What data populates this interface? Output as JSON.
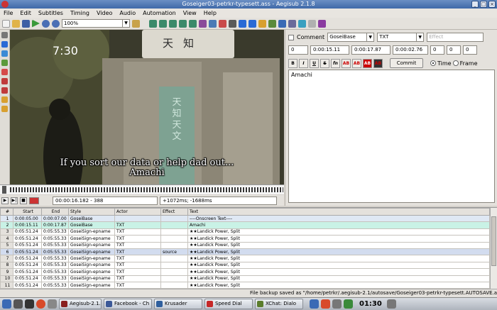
{
  "window": {
    "title": "Goseiger03-petrkr-typesett.ass - Aegisub 2.1.8"
  },
  "menu": [
    "File",
    "Edit",
    "Subtitles",
    "Timing",
    "Video",
    "Audio",
    "Automation",
    "View",
    "Help"
  ],
  "toolbar": {
    "zoom": "100%"
  },
  "video": {
    "clock_overlay": "7:30",
    "sign_text": "天知",
    "pillar_text": "天知天文",
    "subtitle_line1": "If you sort our data or help dad out...",
    "subtitle_line2": "Amachi"
  },
  "video_controls": {
    "position": "00:00:16.182 - 388",
    "offset": "+1072ms; -1688ms"
  },
  "editor": {
    "comment_label": "Comment",
    "style": "GoseiBase",
    "actor": "TXT",
    "effect_placeholder": "Effect",
    "layer": "0",
    "start": "0:00:15.11",
    "end": "0:00:17.87",
    "duration": "0:00:02.76",
    "margin_l": "0",
    "margin_r": "0",
    "margin_v": "0",
    "format_buttons": [
      "B",
      "I",
      "U",
      "S",
      "fn",
      "AB",
      "AB",
      "AB",
      "AB"
    ],
    "commit": "Commit",
    "time_label": "Time",
    "frame_label": "Frame",
    "text": "Amachi"
  },
  "grid": {
    "headers": [
      "#",
      "Start",
      "End",
      "Style",
      "Actor",
      "Effect",
      "Text"
    ],
    "rows": [
      {
        "n": "1",
        "start": "0:00:05.00",
        "end": "0:00:07.00",
        "style": "GoseiBase",
        "actor": "",
        "effect": "",
        "text": "----Onscreen Text----",
        "kind": "comment"
      },
      {
        "n": "2",
        "start": "0:00:15.11",
        "end": "0:00:17.87",
        "style": "GoseiBase",
        "actor": "TXT",
        "effect": "",
        "text": "Amachi",
        "kind": "active"
      },
      {
        "n": "3",
        "start": "0:05:51.24",
        "end": "0:05:55.33",
        "style": "GoseiSign-epname",
        "actor": "TXT",
        "effect": "",
        "text": "★★Landick Power, Split",
        "kind": ""
      },
      {
        "n": "4",
        "start": "0:05:51.24",
        "end": "0:05:55.33",
        "style": "GoseiSign-epname",
        "actor": "TXT",
        "effect": "",
        "text": "★★Landick Power, Split",
        "kind": ""
      },
      {
        "n": "5",
        "start": "0:05:51.24",
        "end": "0:05:55.33",
        "style": "GoseiSign-epname",
        "actor": "TXT",
        "effect": "",
        "text": "★★Landick Power, Split",
        "kind": ""
      },
      {
        "n": "6",
        "start": "0:05:51.24",
        "end": "0:05:55.33",
        "style": "GoseiSign-epname",
        "actor": "TXT",
        "effect": "source",
        "text": "★★Landick Power, Split",
        "kind": "sel"
      },
      {
        "n": "7",
        "start": "0:05:51.24",
        "end": "0:05:55.33",
        "style": "GoseiSign-epname",
        "actor": "TXT",
        "effect": "",
        "text": "★★Landick Power, Split",
        "kind": ""
      },
      {
        "n": "8",
        "start": "0:05:51.24",
        "end": "0:05:55.33",
        "style": "GoseiSign-epname",
        "actor": "TXT",
        "effect": "",
        "text": "★★Landick Power, Split",
        "kind": ""
      },
      {
        "n": "9",
        "start": "0:05:51.24",
        "end": "0:05:55.33",
        "style": "GoseiSign-epname",
        "actor": "TXT",
        "effect": "",
        "text": "★★Landick Power, Split",
        "kind": ""
      },
      {
        "n": "10",
        "start": "0:05:51.24",
        "end": "0:05:55.33",
        "style": "GoseiSign-epname",
        "actor": "TXT",
        "effect": "",
        "text": "★★Landick Power, Split",
        "kind": ""
      },
      {
        "n": "11",
        "start": "0:05:51.24",
        "end": "0:05:55.33",
        "style": "GoseiSign-epname",
        "actor": "TXT",
        "effect": "",
        "text": "★★Landick Power, Split",
        "kind": ""
      }
    ]
  },
  "status": {
    "text": "File backup saved as \"/home/petrkr/.aegisub-2.1/autosave/Goseiger03-petrkr-typesett.AUTOSAVE.a"
  },
  "taskbar": {
    "tasks": [
      {
        "label": "Aegisub-2.1.",
        "color": "#8a1f1f"
      },
      {
        "label": "Facebook - Ch",
        "color": "#3b5998"
      },
      {
        "label": "Krusader",
        "color": "#2f5f9e"
      },
      {
        "label": "Speed Dial",
        "color": "#c62828"
      },
      {
        "label": "XChat: Dialo",
        "color": "#5b7d2c"
      }
    ],
    "clock": "01:30"
  }
}
